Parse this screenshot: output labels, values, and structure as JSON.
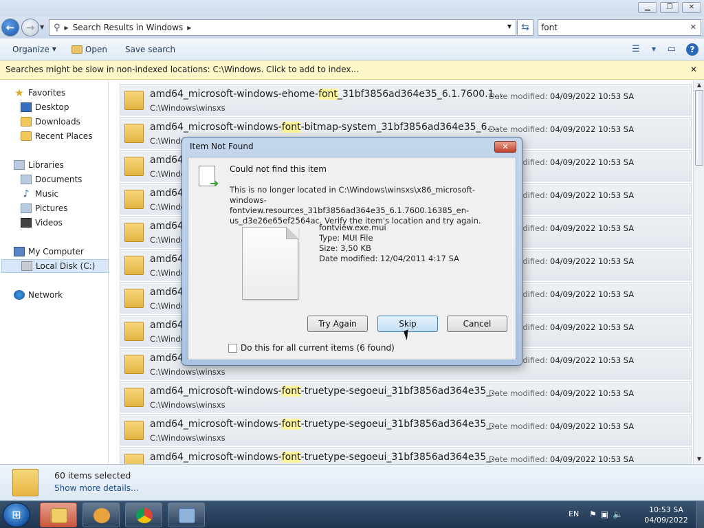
{
  "window": {
    "caption_buttons": [
      "minimize",
      "maximize",
      "close"
    ]
  },
  "address": {
    "path": "Search Results in Windows",
    "search_value": "font"
  },
  "toolbar": {
    "organize": "Organize",
    "open": "Open",
    "save_search": "Save search"
  },
  "infobar": {
    "text": "Searches might be slow in non-indexed locations: C:\\Windows. Click to add to index..."
  },
  "nav": {
    "favorites": "Favorites",
    "desktop": "Desktop",
    "downloads": "Downloads",
    "recent": "Recent Places",
    "libraries": "Libraries",
    "documents": "Documents",
    "music": "Music",
    "pictures": "Pictures",
    "videos": "Videos",
    "computer": "My Computer",
    "localdisk": "Local Disk (C:)",
    "network": "Network"
  },
  "results": {
    "date_label": "Date modified:",
    "rows": [
      {
        "pre": "amd64_microsoft-windows-ehome-",
        "hl": "font",
        "post": "_31bf3856ad364e35_6.1.7600.1...",
        "path": "C:\\Windows\\winsxs",
        "date": "04/09/2022 10:53 SA"
      },
      {
        "pre": "amd64_microsoft-windows-",
        "hl": "font",
        "post": "-bitmap-system_31bf3856ad364e35_6....",
        "path": "C:\\Windo",
        "date": "04/09/2022 10:53 SA"
      },
      {
        "pre": "amd64",
        "hl": "",
        "post": "",
        "path": "C:\\Windo",
        "date": "04/09/2022 10:53 SA"
      },
      {
        "pre": "amd64",
        "hl": "",
        "post": "",
        "path": "C:\\Windo",
        "date": "04/09/2022 10:53 SA"
      },
      {
        "pre": "amd64",
        "hl": "",
        "post": "",
        "path": "C:\\Windo",
        "date": "04/09/2022 10:53 SA"
      },
      {
        "pre": "amd64",
        "hl": "",
        "post": "",
        "path": "C:\\Windo",
        "date": "04/09/2022 10:53 SA"
      },
      {
        "pre": "amd64",
        "hl": "",
        "post": "",
        "path": "C:\\Windo",
        "date": "04/09/2022 10:53 SA"
      },
      {
        "pre": "amd64",
        "hl": "",
        "post": "",
        "path": "C:\\Windo",
        "date": "04/09/2022 10:53 SA"
      },
      {
        "pre": "amd64",
        "hl": "",
        "post": "",
        "path": "C:\\Windows\\winsxs",
        "date": "04/09/2022 10:53 SA"
      },
      {
        "pre": "amd64_microsoft-windows-",
        "hl": "font",
        "post": "-truetype-segoeui_31bf3856ad364e35_...",
        "path": "C:\\Windows\\winsxs",
        "date": "04/09/2022 10:53 SA"
      },
      {
        "pre": "amd64_microsoft-windows-",
        "hl": "font",
        "post": "-truetype-segoeui_31bf3856ad364e35_...",
        "path": "C:\\Windows\\winsxs",
        "date": "04/09/2022 10:53 SA"
      },
      {
        "pre": "amd64_microsoft-windows-",
        "hl": "font",
        "post": "-truetype-segoeui_31bf3856ad364e35_...",
        "path": "",
        "date": "04/09/2022 10:53 SA"
      }
    ]
  },
  "details": {
    "count": "60 items selected",
    "more": "Show more details..."
  },
  "dialog": {
    "title": "Item Not Found",
    "heading": "Could not find this item",
    "message": "This is no longer located in C:\\Windows\\winsxs\\x86_microsoft-windows-fontview.resources_31bf3856ad364e35_6.1.7600.16385_en-us_d3e26e65ef2564ac. Verify the item's location and try again.",
    "file_name": "fontview.exe.mui",
    "file_type": "Type: MUI File",
    "file_size": "Size: 3,50 KB",
    "file_date": "Date modified: 12/04/2011 4:17 SA",
    "try_again": "Try Again",
    "skip": "Skip",
    "cancel": "Cancel",
    "checkbox_label": "Do this for all current items (6 found)"
  },
  "taskbar": {
    "lang": "EN",
    "time": "10:53 SA",
    "date": "04/09/2022"
  }
}
